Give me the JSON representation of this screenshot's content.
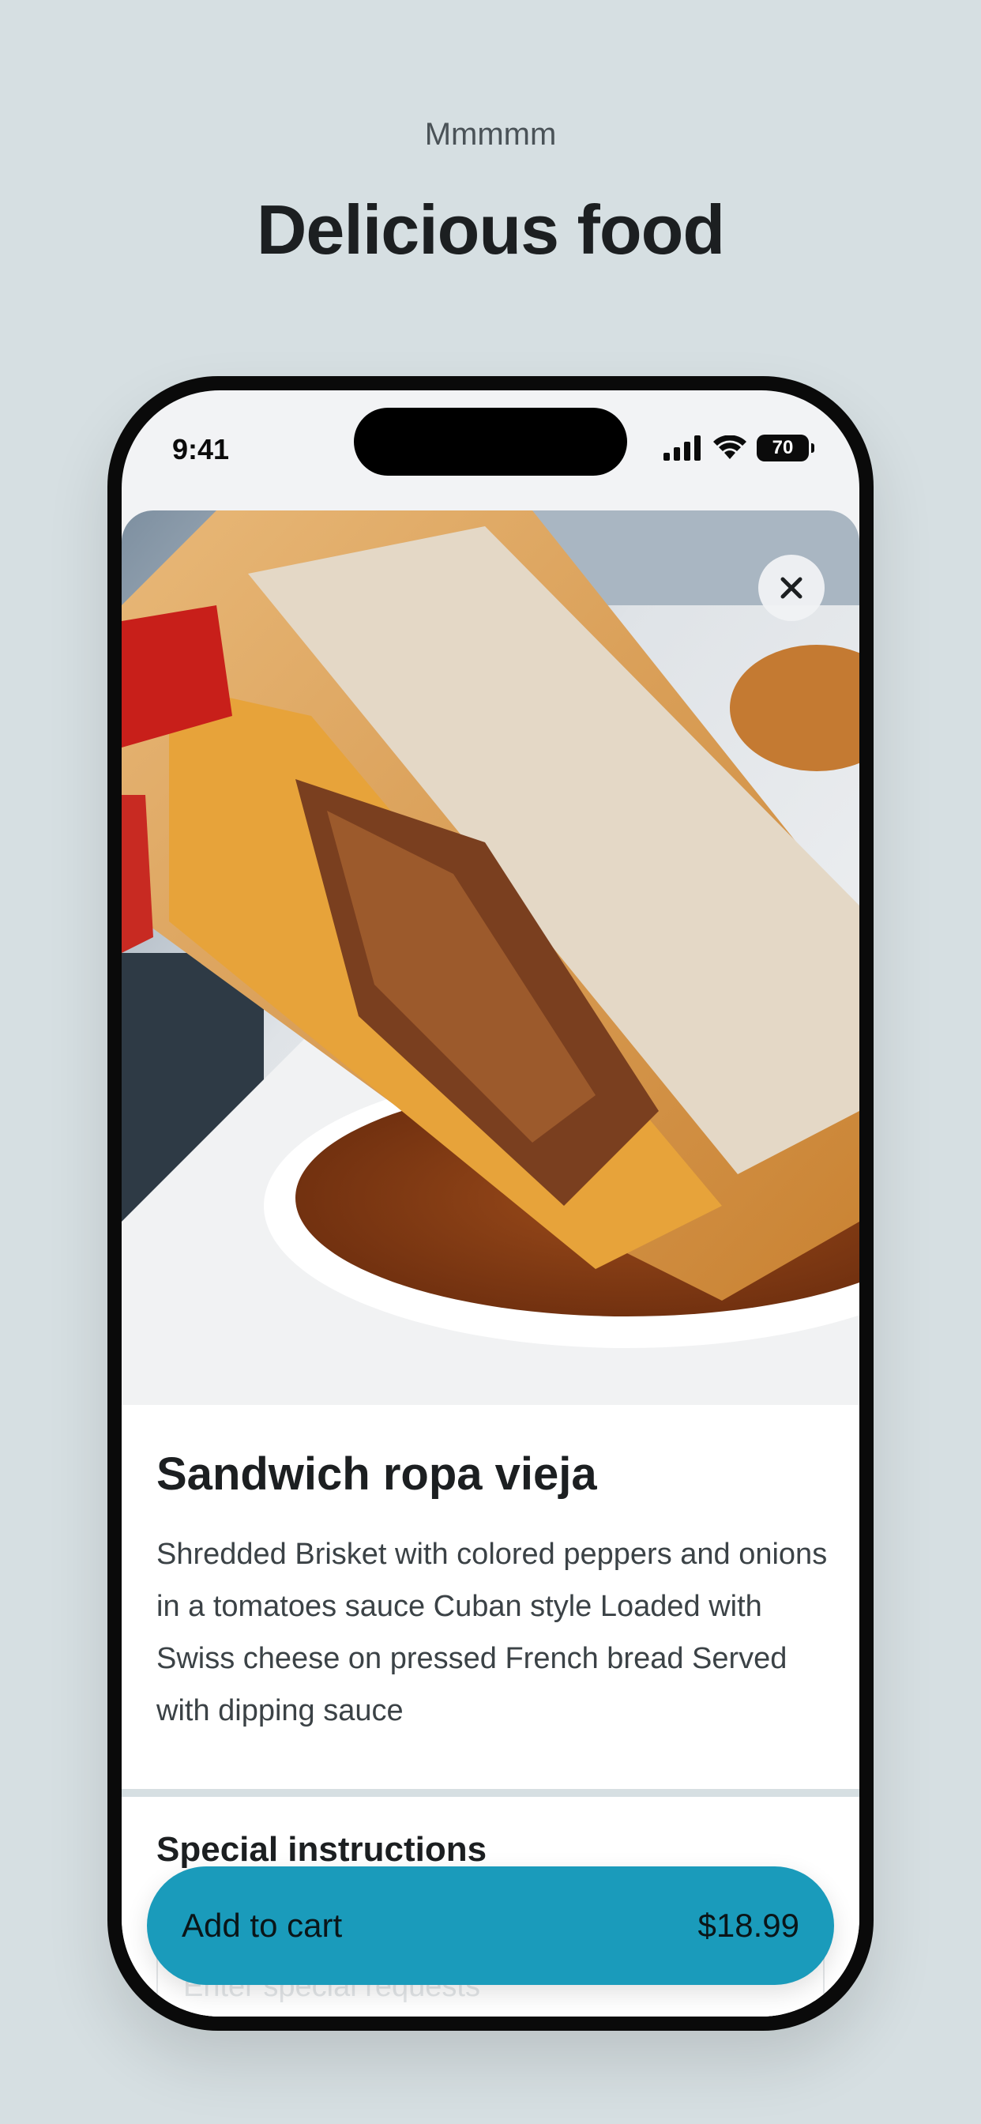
{
  "header": {
    "eyebrow": "Mmmmm",
    "title": "Delicious food"
  },
  "status_bar": {
    "time": "9:41",
    "battery": "70",
    "icons": [
      "signal-icon",
      "wifi-icon",
      "battery-icon"
    ]
  },
  "item": {
    "image_alt": "Sandwich ropa vieja dipped in sauce",
    "close_icon": "close-icon",
    "name": "Sandwich ropa vieja",
    "description": "Shredded Brisket with colored peppers and onions in a tomatoes sauce Cuban style Loaded with Swiss cheese on pressed French bread Served with dipping sauce"
  },
  "special_instructions": {
    "title": "Special instructions",
    "placeholder": "Enter special requests"
  },
  "cart": {
    "label": "Add to cart",
    "price": "$18.99"
  },
  "colors": {
    "background": "#d6dfe2",
    "accent": "#1a9bbb",
    "text": "#1c1f21"
  }
}
